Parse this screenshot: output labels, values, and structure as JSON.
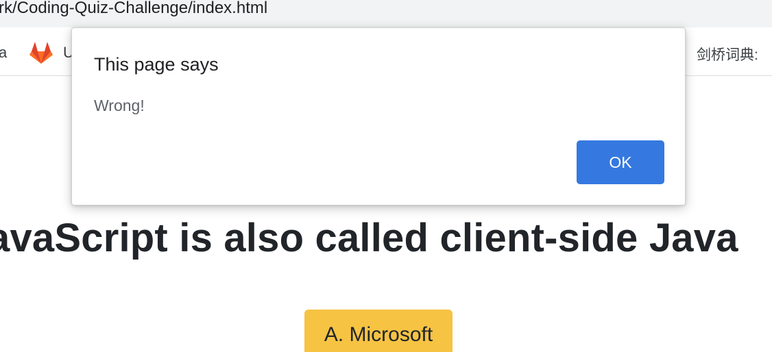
{
  "browser": {
    "url_fragment": "rk/Coding-Quiz-Challenge/index.html"
  },
  "bookmarks": {
    "left_partial": "a",
    "gitlab_partial": "U",
    "right_item": "剑桥词典:",
    "icons": [
      "gitlab-icon"
    ]
  },
  "page": {
    "question": "avaScript is also called client-side Java",
    "answer_a": "A. Microsoft"
  },
  "dialog": {
    "title": "This page says",
    "message": "Wrong!",
    "ok_label": "OK"
  },
  "colors": {
    "ok_button": "#3579e0",
    "answer_button": "#f6c343",
    "text_dark": "#212529"
  }
}
